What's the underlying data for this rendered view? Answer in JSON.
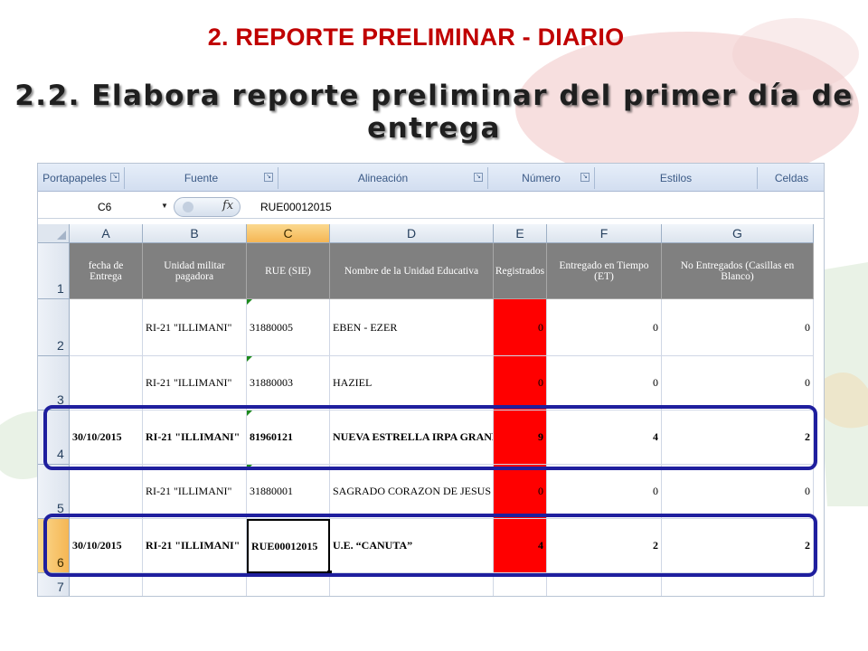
{
  "slide": {
    "title": "2. REPORTE  PRELIMINAR  - DIARIO",
    "subtitle": "2.2. Elabora reporte preliminar del primer día de entrega"
  },
  "colors": {
    "title_red": "#c00000",
    "header_grey": "#808080",
    "registrados_red": "#ff0000",
    "highlight_blue": "#1f1f9e",
    "active_header": "#f5b654"
  },
  "ribbon": {
    "groups": [
      "Portapapeles",
      "Fuente",
      "Alineación",
      "Número",
      "Estilos",
      "Celdas"
    ]
  },
  "formula_bar": {
    "name_box": "C6",
    "fx": "fx",
    "value": "RUE00012015"
  },
  "sheet": {
    "columns": [
      "A",
      "B",
      "C",
      "D",
      "E",
      "F",
      "G"
    ],
    "rows": [
      "1",
      "2",
      "3",
      "4",
      "5",
      "6",
      "7"
    ],
    "headers": [
      "fecha de Entrega",
      "Unidad militar pagadora",
      "RUE (SIE)",
      "Nombre de la Unidad Educativa",
      "Registrados",
      "Entregado en Tiempo (ET)",
      "No Entregados (Casillas en Blanco)"
    ],
    "data": [
      [
        "",
        "RI-21 \"ILLIMANI\"",
        "31880005",
        "EBEN - EZER",
        "0",
        "0",
        "0"
      ],
      [
        "",
        "RI-21 \"ILLIMANI\"",
        "31880003",
        "HAZIEL",
        "0",
        "0",
        "0"
      ],
      [
        "30/10/2015",
        "RI-21 \"ILLIMANI\"",
        "81960121",
        "NUEVA ESTRELLA IRPA GRANDE",
        "9",
        "4",
        "2"
      ],
      [
        "",
        "RI-21 \"ILLIMANI\"",
        "31880001",
        "SAGRADO CORAZON DE JESUS",
        "0",
        "0",
        "0"
      ],
      [
        "30/10/2015",
        "RI-21 \"ILLIMANI\"",
        "RUE00012015",
        "U.E. “CANUTA”",
        "4",
        "2",
        "2"
      ]
    ]
  }
}
